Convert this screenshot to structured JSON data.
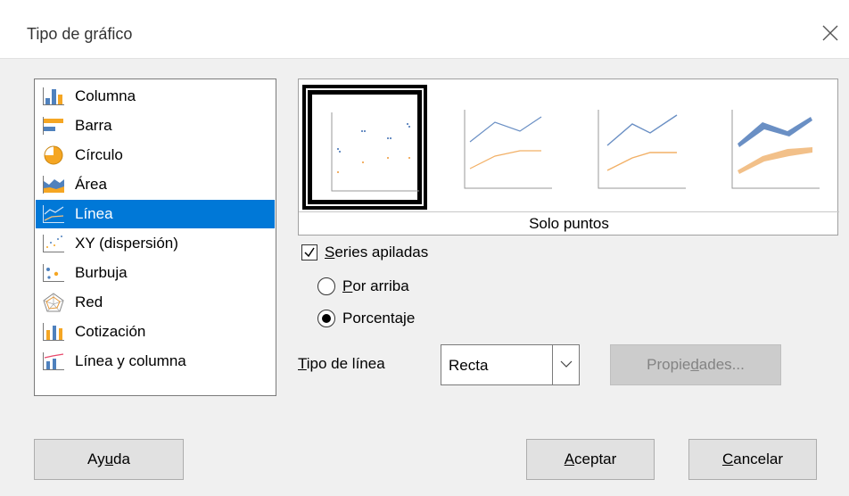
{
  "dialog": {
    "title": "Tipo de gráfico"
  },
  "chart_types": [
    {
      "label": "Columna",
      "icon": "column-chart-icon"
    },
    {
      "label": "Barra",
      "icon": "bar-chart-icon"
    },
    {
      "label": "Círculo",
      "icon": "pie-chart-icon"
    },
    {
      "label": "Área",
      "icon": "area-chart-icon"
    },
    {
      "label": "Línea",
      "icon": "line-chart-icon",
      "selected": true
    },
    {
      "label": "XY (dispersión)",
      "icon": "xy-scatter-icon"
    },
    {
      "label": "Burbuja",
      "icon": "bubble-chart-icon"
    },
    {
      "label": "Red",
      "icon": "net-chart-icon"
    },
    {
      "label": "Cotización",
      "icon": "stock-chart-icon"
    },
    {
      "label": "Línea y columna",
      "icon": "column-line-chart-icon"
    }
  ],
  "variants": {
    "selected_name": "Solo puntos",
    "items": [
      "points-only-variant",
      "points-and-lines-variant",
      "lines-only-variant",
      "3d-lines-variant"
    ]
  },
  "options": {
    "stacked_label_prefix": "",
    "stacked_label_u": "S",
    "stacked_label_rest": "eries apiladas",
    "stacked_checked": true,
    "on_top_u": "P",
    "on_top_rest": "or arriba",
    "percent_pre": "Porcenta",
    "percent_u": "j",
    "percent_rest": "e",
    "percent_selected": true
  },
  "line_type": {
    "label_u": "T",
    "label_rest": "ipo de línea",
    "value": "Recta"
  },
  "buttons": {
    "properties_pre": "Propie",
    "properties_u": "d",
    "properties_rest": "ades...",
    "help_pre": "Ay",
    "help_u": "u",
    "help_rest": "da",
    "ok_u": "A",
    "ok_rest": "ceptar",
    "cancel_u": "C",
    "cancel_rest": "ancelar"
  },
  "colors": {
    "selection": "#0078d7",
    "series_blue": "#4f81bd",
    "series_orange": "#f5b971"
  }
}
